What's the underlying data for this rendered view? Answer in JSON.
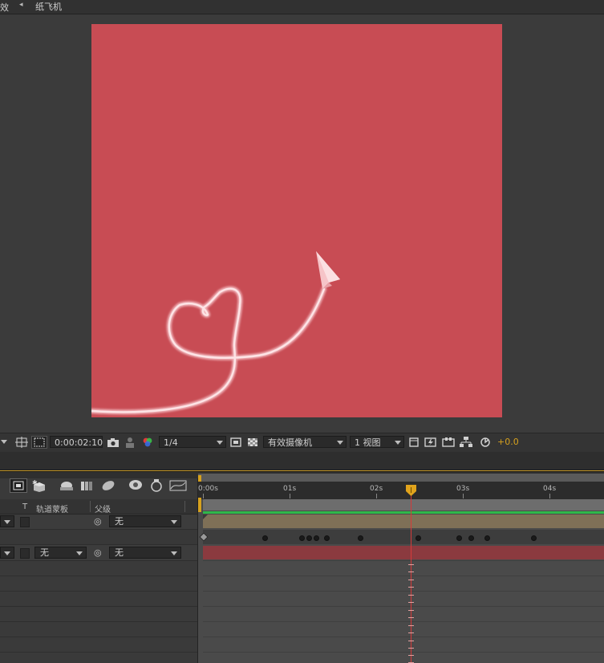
{
  "tabs": {
    "effects_tab_label": "效",
    "comp_tab_label": "纸飞机"
  },
  "viewer": {
    "background_color": "#c84c54",
    "timecode": "0:00:02:10",
    "resolution": "1/4",
    "camera": "有效摄像机",
    "views": "1 视图",
    "exposure": "+0.0"
  },
  "timeline": {
    "headers": {
      "t_label": "T",
      "trkmat_label": "轨道蒙板",
      "parent_label": "父级"
    },
    "ruler": [
      "0:00s",
      "01s",
      "02s",
      "03s",
      "04s"
    ],
    "layers": [
      {
        "trkmat": "",
        "parent": "无",
        "bar_color": "#7f7057"
      },
      {
        "trkmat": "无",
        "parent": "无",
        "bar_color": "#8b3a3f"
      }
    ]
  }
}
